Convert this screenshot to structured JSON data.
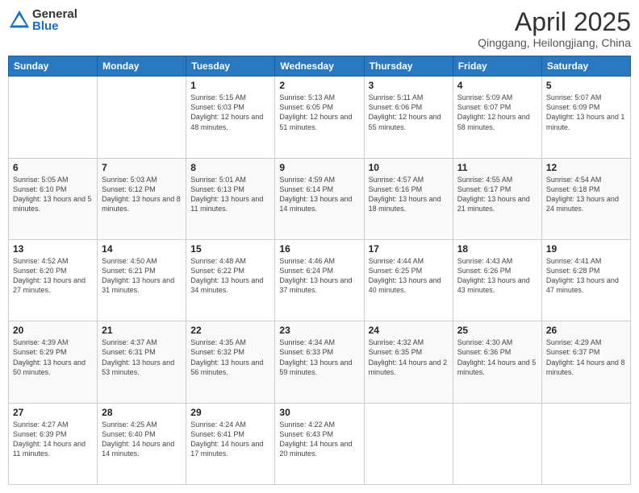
{
  "logo": {
    "general": "General",
    "blue": "Blue"
  },
  "title": {
    "main": "April 2025",
    "sub": "Qinggang, Heilongjiang, China"
  },
  "days": [
    "Sunday",
    "Monday",
    "Tuesday",
    "Wednesday",
    "Thursday",
    "Friday",
    "Saturday"
  ],
  "weeks": [
    [
      {
        "day": "",
        "content": ""
      },
      {
        "day": "",
        "content": ""
      },
      {
        "day": "1",
        "content": "Sunrise: 5:15 AM\nSunset: 6:03 PM\nDaylight: 12 hours and 48 minutes."
      },
      {
        "day": "2",
        "content": "Sunrise: 5:13 AM\nSunset: 6:05 PM\nDaylight: 12 hours and 51 minutes."
      },
      {
        "day": "3",
        "content": "Sunrise: 5:11 AM\nSunset: 6:06 PM\nDaylight: 12 hours and 55 minutes."
      },
      {
        "day": "4",
        "content": "Sunrise: 5:09 AM\nSunset: 6:07 PM\nDaylight: 12 hours and 58 minutes."
      },
      {
        "day": "5",
        "content": "Sunrise: 5:07 AM\nSunset: 6:09 PM\nDaylight: 13 hours and 1 minute."
      }
    ],
    [
      {
        "day": "6",
        "content": "Sunrise: 5:05 AM\nSunset: 6:10 PM\nDaylight: 13 hours and 5 minutes."
      },
      {
        "day": "7",
        "content": "Sunrise: 5:03 AM\nSunset: 6:12 PM\nDaylight: 13 hours and 8 minutes."
      },
      {
        "day": "8",
        "content": "Sunrise: 5:01 AM\nSunset: 6:13 PM\nDaylight: 13 hours and 11 minutes."
      },
      {
        "day": "9",
        "content": "Sunrise: 4:59 AM\nSunset: 6:14 PM\nDaylight: 13 hours and 14 minutes."
      },
      {
        "day": "10",
        "content": "Sunrise: 4:57 AM\nSunset: 6:16 PM\nDaylight: 13 hours and 18 minutes."
      },
      {
        "day": "11",
        "content": "Sunrise: 4:55 AM\nSunset: 6:17 PM\nDaylight: 13 hours and 21 minutes."
      },
      {
        "day": "12",
        "content": "Sunrise: 4:54 AM\nSunset: 6:18 PM\nDaylight: 13 hours and 24 minutes."
      }
    ],
    [
      {
        "day": "13",
        "content": "Sunrise: 4:52 AM\nSunset: 6:20 PM\nDaylight: 13 hours and 27 minutes."
      },
      {
        "day": "14",
        "content": "Sunrise: 4:50 AM\nSunset: 6:21 PM\nDaylight: 13 hours and 31 minutes."
      },
      {
        "day": "15",
        "content": "Sunrise: 4:48 AM\nSunset: 6:22 PM\nDaylight: 13 hours and 34 minutes."
      },
      {
        "day": "16",
        "content": "Sunrise: 4:46 AM\nSunset: 6:24 PM\nDaylight: 13 hours and 37 minutes."
      },
      {
        "day": "17",
        "content": "Sunrise: 4:44 AM\nSunset: 6:25 PM\nDaylight: 13 hours and 40 minutes."
      },
      {
        "day": "18",
        "content": "Sunrise: 4:43 AM\nSunset: 6:26 PM\nDaylight: 13 hours and 43 minutes."
      },
      {
        "day": "19",
        "content": "Sunrise: 4:41 AM\nSunset: 6:28 PM\nDaylight: 13 hours and 47 minutes."
      }
    ],
    [
      {
        "day": "20",
        "content": "Sunrise: 4:39 AM\nSunset: 6:29 PM\nDaylight: 13 hours and 50 minutes."
      },
      {
        "day": "21",
        "content": "Sunrise: 4:37 AM\nSunset: 6:31 PM\nDaylight: 13 hours and 53 minutes."
      },
      {
        "day": "22",
        "content": "Sunrise: 4:35 AM\nSunset: 6:32 PM\nDaylight: 13 hours and 56 minutes."
      },
      {
        "day": "23",
        "content": "Sunrise: 4:34 AM\nSunset: 6:33 PM\nDaylight: 13 hours and 59 minutes."
      },
      {
        "day": "24",
        "content": "Sunrise: 4:32 AM\nSunset: 6:35 PM\nDaylight: 14 hours and 2 minutes."
      },
      {
        "day": "25",
        "content": "Sunrise: 4:30 AM\nSunset: 6:36 PM\nDaylight: 14 hours and 5 minutes."
      },
      {
        "day": "26",
        "content": "Sunrise: 4:29 AM\nSunset: 6:37 PM\nDaylight: 14 hours and 8 minutes."
      }
    ],
    [
      {
        "day": "27",
        "content": "Sunrise: 4:27 AM\nSunset: 6:39 PM\nDaylight: 14 hours and 11 minutes."
      },
      {
        "day": "28",
        "content": "Sunrise: 4:25 AM\nSunset: 6:40 PM\nDaylight: 14 hours and 14 minutes."
      },
      {
        "day": "29",
        "content": "Sunrise: 4:24 AM\nSunset: 6:41 PM\nDaylight: 14 hours and 17 minutes."
      },
      {
        "day": "30",
        "content": "Sunrise: 4:22 AM\nSunset: 6:43 PM\nDaylight: 14 hours and 20 minutes."
      },
      {
        "day": "",
        "content": ""
      },
      {
        "day": "",
        "content": ""
      },
      {
        "day": "",
        "content": ""
      }
    ]
  ]
}
